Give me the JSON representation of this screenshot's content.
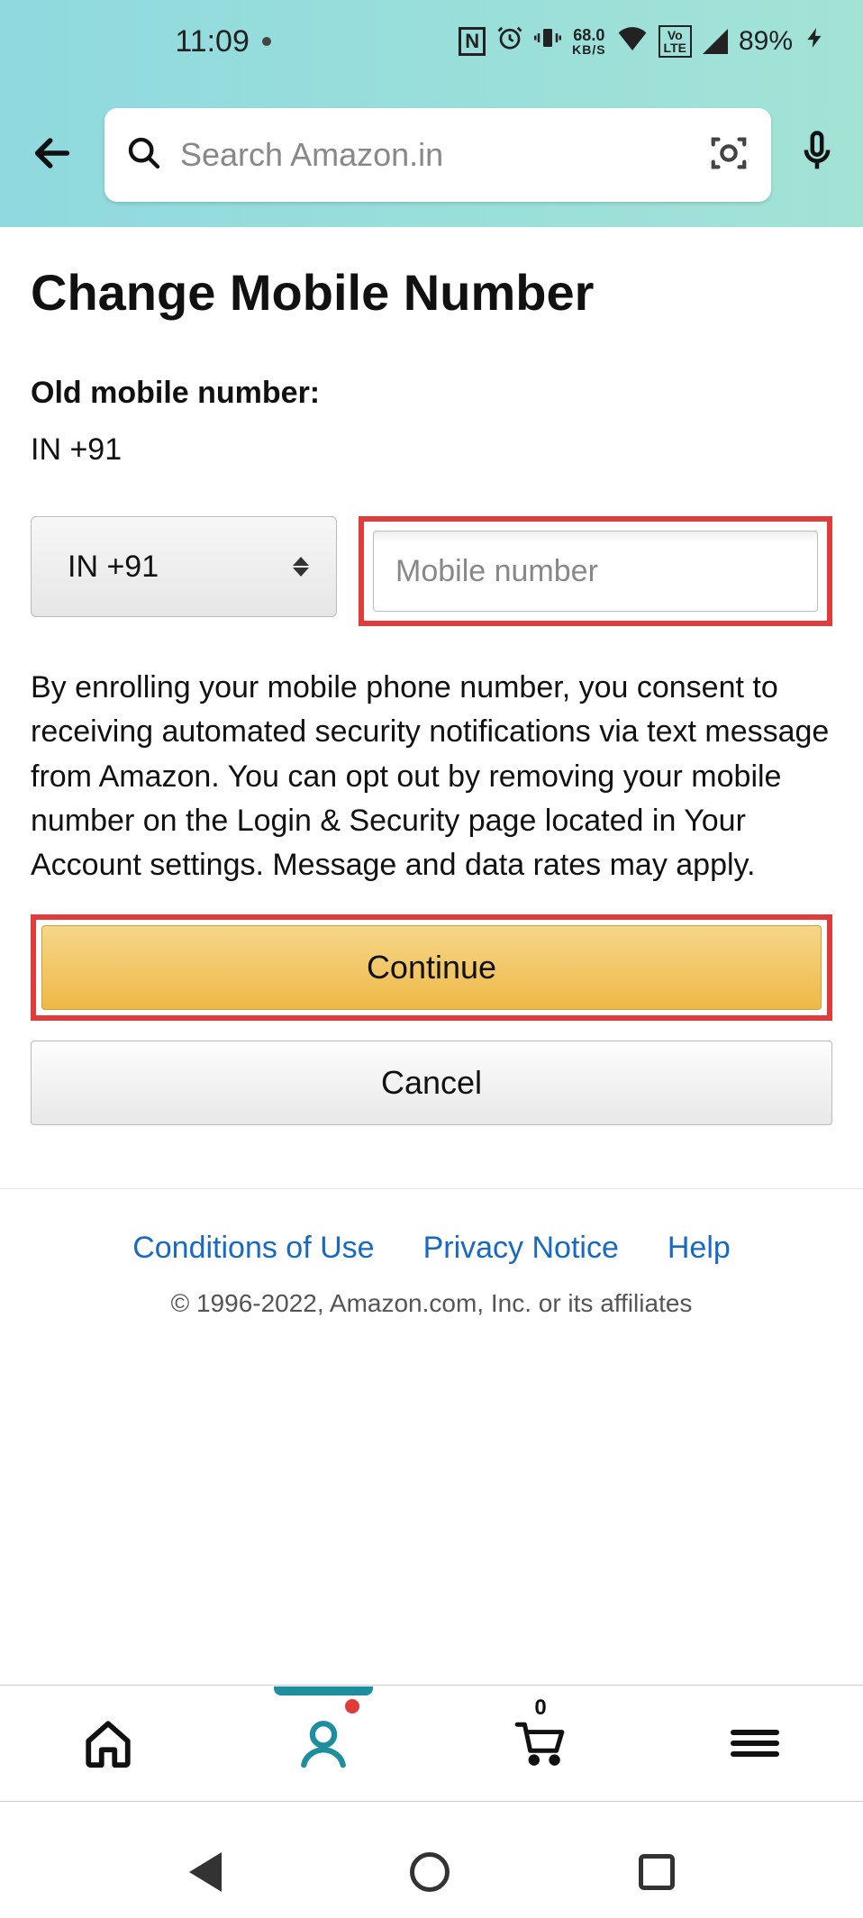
{
  "status": {
    "time": "11:09",
    "net_speed": "68.0",
    "net_unit": "KB/S",
    "lte_top": "Vo",
    "lte_bot": "LTE",
    "battery": "89%"
  },
  "header": {
    "search_placeholder": "Search Amazon.in"
  },
  "page": {
    "title": "Change Mobile Number",
    "old_label": "Old mobile number:",
    "old_value": "IN +91",
    "country_code_display": "IN +91",
    "mobile_placeholder": "Mobile number",
    "consent_text": "By enrolling your mobile phone number, you consent to receiving automated security notifications via text message from Amazon. You can opt out by removing your mobile number on the Login & Security page located in Your Account settings. Message and data rates may apply.",
    "continue_label": "Continue",
    "cancel_label": "Cancel"
  },
  "footer": {
    "links": [
      "Conditions of Use",
      "Privacy Notice",
      "Help"
    ],
    "copyright": "© 1996-2022, Amazon.com, Inc. or its affiliates"
  },
  "tabs": {
    "cart_count": "0"
  }
}
